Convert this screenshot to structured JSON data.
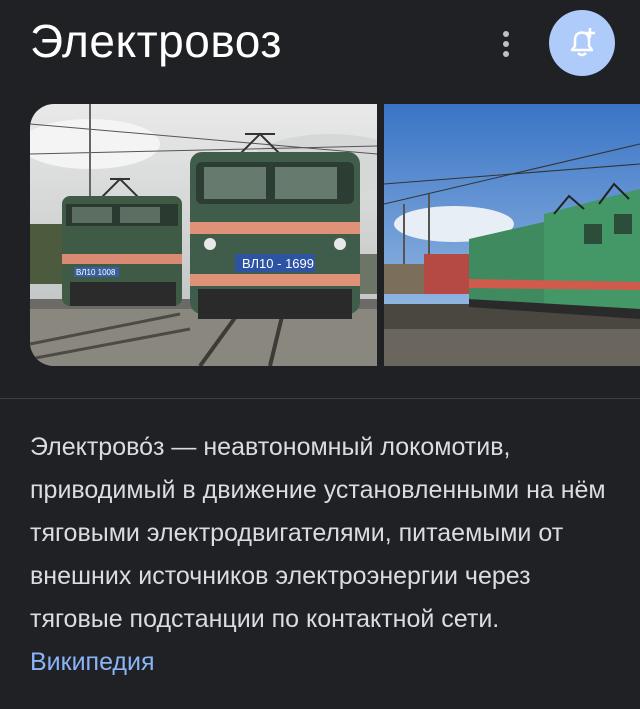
{
  "header": {
    "title": "Электровоз"
  },
  "icons": {
    "more": "more-vert-icon",
    "bell": "bell-plus-icon"
  },
  "images": [
    {
      "plate_text": "ВЛ10 - 1699",
      "plate_text_2": "ВЛ10 1008"
    },
    {
      "subject": "green-electric-locomotive-train"
    }
  ],
  "description": {
    "text": "Электрово́з — неавтономный локомотив, приводимый в движение установленными на нём тяговыми электродвигателями, питаемыми от внешних источников электроэнергии через тяговые подстанции по контактной сети.",
    "source_link": "Википедия"
  },
  "colors": {
    "background": "#202124",
    "link": "#8ab4f8",
    "bell_button": "#aecbfa"
  }
}
